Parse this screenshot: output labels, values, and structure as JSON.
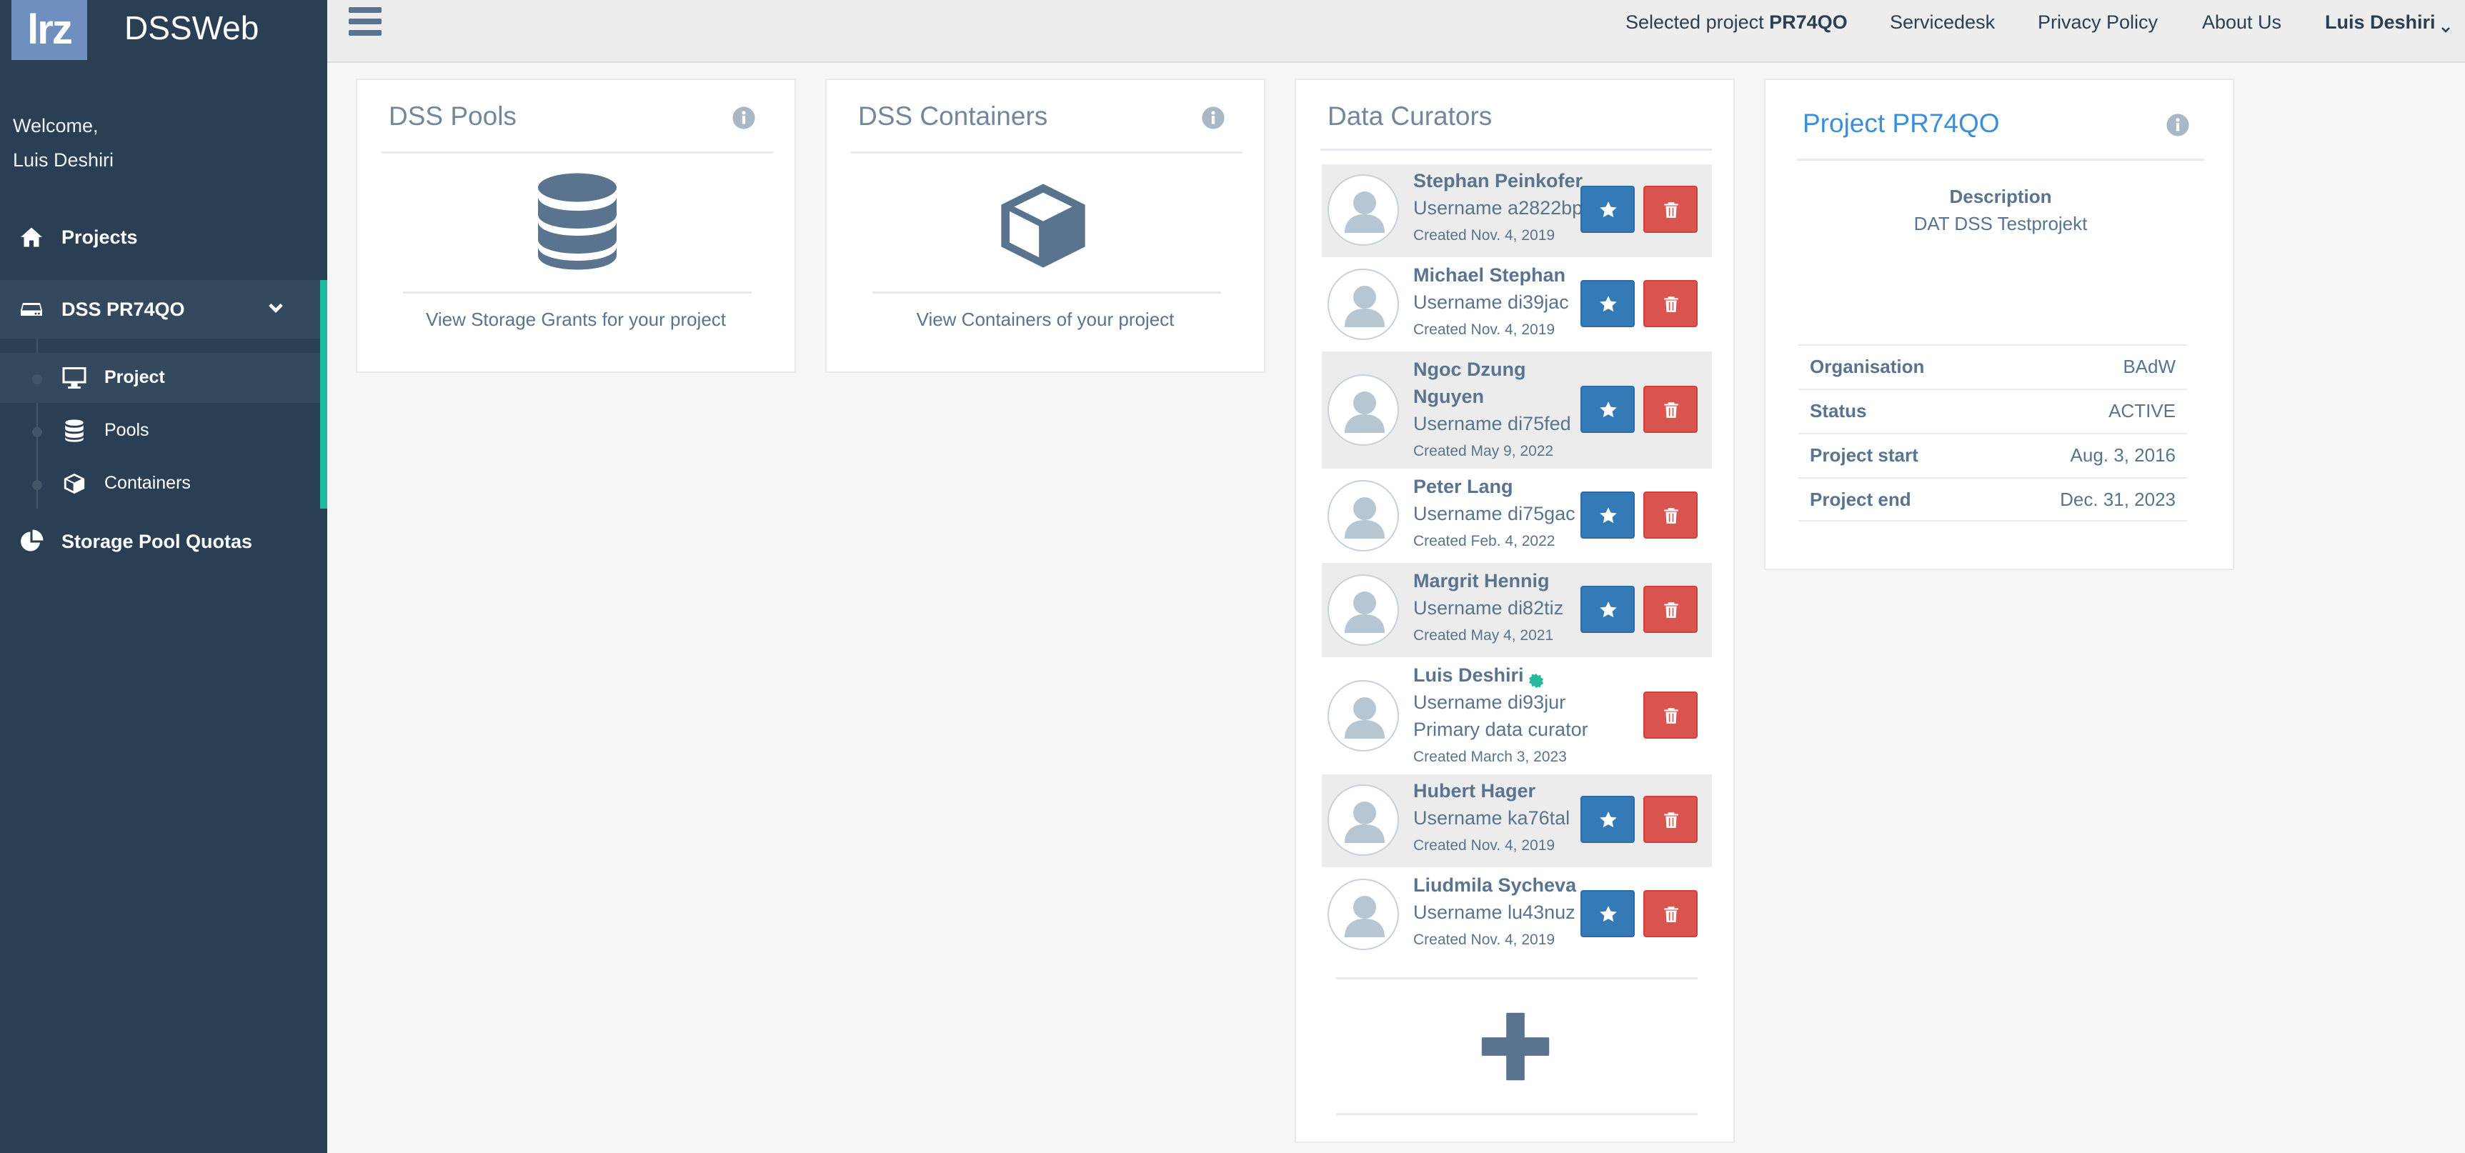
{
  "app": {
    "logo_text": "lrz",
    "name": "DSSWeb"
  },
  "sidebar": {
    "welcome": "Welcome,",
    "user_name": "Luis Deshiri",
    "items": [
      {
        "label": "Projects",
        "icon": "home-icon"
      },
      {
        "label": "DSS PR74QO",
        "icon": "drive-icon"
      },
      {
        "label": "Storage Pool Quotas",
        "icon": "pie-chart-icon"
      }
    ],
    "sub_items": [
      {
        "label": "Project",
        "icon": "desktop-icon",
        "active": true
      },
      {
        "label": "Pools",
        "icon": "database-icon"
      },
      {
        "label": "Containers",
        "icon": "cube-icon"
      }
    ]
  },
  "topbar": {
    "selected_prefix": "Selected project ",
    "selected_project": "PR74QO",
    "links": [
      "Servicedesk",
      "Privacy Policy",
      "About Us"
    ],
    "user": "Luis Deshiri"
  },
  "pools_panel": {
    "title": "DSS Pools",
    "link": "View Storage Grants for your project",
    "icon": "database-icon"
  },
  "containers_panel": {
    "title": "DSS Containers",
    "link": "View Containers of your project",
    "icon": "cube-icon"
  },
  "curators_panel": {
    "title": "Data Curators",
    "curators": [
      {
        "name": "Stephan Peinkofer",
        "username": "Username a2822bp",
        "created": "Created Nov. 4, 2019"
      },
      {
        "name": "Michael Stephan",
        "username": "Username di39jac",
        "created": "Created Nov. 4, 2019"
      },
      {
        "name": "Ngoc Dzung Nguyen",
        "username": "Username di75fed",
        "created": "Created May 9, 2022"
      },
      {
        "name": "Peter Lang",
        "username": "Username di75gac",
        "created": "Created Feb. 4, 2022"
      },
      {
        "name": "Margrit Hennig",
        "username": "Username di82tiz",
        "created": "Created May 4, 2021"
      },
      {
        "name": "Luis Deshiri",
        "username": "Username di93jur",
        "role": "Primary data curator",
        "created": "Created March 3, 2023"
      },
      {
        "name": "Hubert Hager",
        "username": "Username ka76tal",
        "created": "Created Nov. 4, 2019"
      },
      {
        "name": "Liudmila Sycheva",
        "username": "Username lu43nuz",
        "created": "Created Nov. 4, 2019"
      }
    ]
  },
  "project_panel": {
    "title": "Project PR74QO",
    "description_label": "Description",
    "description": "DAT DSS Testprojekt",
    "fields": [
      {
        "key": "Organisation",
        "value": "BAdW"
      },
      {
        "key": "Status",
        "value": "ACTIVE"
      },
      {
        "key": "Project start",
        "value": "Aug. 3, 2016"
      },
      {
        "key": "Project end",
        "value": "Dec. 31, 2023"
      }
    ]
  },
  "colors": {
    "sidebar": "#2a3f54",
    "accent": "#1abb9c",
    "primary": "#337ab7",
    "danger": "#d9534f",
    "title_blue": "#3a8fd8"
  }
}
